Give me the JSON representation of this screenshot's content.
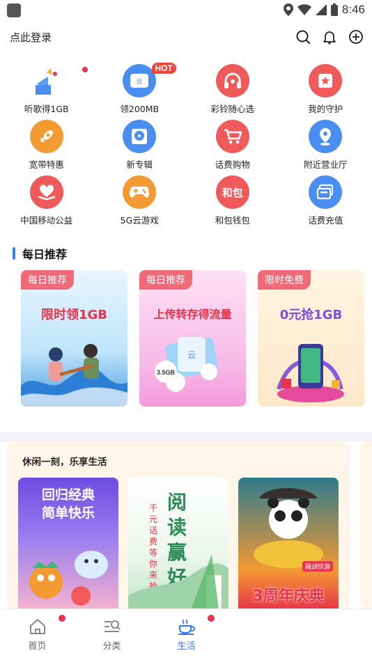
{
  "status_bar": {
    "time": "8:46"
  },
  "header": {
    "login_text": "点此登录"
  },
  "grid": [
    {
      "label": "听歌得1GB",
      "icon": "music-gift-icon",
      "color": "#ffffff",
      "badge_dot": true
    },
    {
      "label": "领200MB",
      "icon": "cloud-drive-icon",
      "color": "#4b8ef1",
      "badge": "HOT"
    },
    {
      "label": "彩铃随心选",
      "icon": "headphones-icon",
      "color": "#f05a5a"
    },
    {
      "label": "我的守护",
      "icon": "star-shield-icon",
      "color": "#f05a5a"
    },
    {
      "label": "宽带特惠",
      "icon": "rocket-icon",
      "color": "#f39a33"
    },
    {
      "label": "新专辑",
      "icon": "cd-album-icon",
      "color": "#4b8ef1"
    },
    {
      "label": "话费购物",
      "icon": "shopping-cart-icon",
      "color": "#f05a5a"
    },
    {
      "label": "附近营业厅",
      "icon": "location-pin-icon",
      "color": "#4b8ef1"
    },
    {
      "label": "中国移动公益",
      "icon": "heart-hand-icon",
      "color": "#f05a5a"
    },
    {
      "label": "5G云游戏",
      "icon": "gamepad-icon",
      "color": "#f39a33"
    },
    {
      "label": "和包钱包",
      "icon": "hebao-wallet-icon",
      "color": "#f05a5a",
      "icon_text": "和包"
    },
    {
      "label": "话费充值",
      "icon": "recharge-card-icon",
      "color": "#4b8ef1"
    }
  ],
  "daily": {
    "title": "每日推荐",
    "cards": [
      {
        "tag": "每日推荐",
        "text": "限时领1GB",
        "tag_color": "#f06a78",
        "text_color": "#e8334a"
      },
      {
        "tag": "每日推荐",
        "text": "上传转存得流量",
        "tag_color": "#f06a78",
        "text_color": "#e8334a"
      },
      {
        "tag": "限时免费",
        "text": "0元抢1GB",
        "tag_color": "#f06a78",
        "text_color": "#7b4fd8"
      }
    ]
  },
  "leisure": {
    "title": "休闲一刻，乐享生活",
    "cards": [
      {
        "line1": "回归经典",
        "line2": "简单快乐"
      },
      {
        "big": "阅读赢好礼",
        "small": "千元话费等你来抢"
      },
      {
        "badge": "融胡快游",
        "big": "3周年庆典"
      }
    ]
  },
  "nav": [
    {
      "label": "首页",
      "icon": "home-icon",
      "dot": true,
      "active": false
    },
    {
      "label": "分类",
      "icon": "category-icon",
      "dot": false,
      "active": false
    },
    {
      "label": "生活",
      "icon": "coffee-cup-icon",
      "dot": true,
      "active": true
    }
  ]
}
